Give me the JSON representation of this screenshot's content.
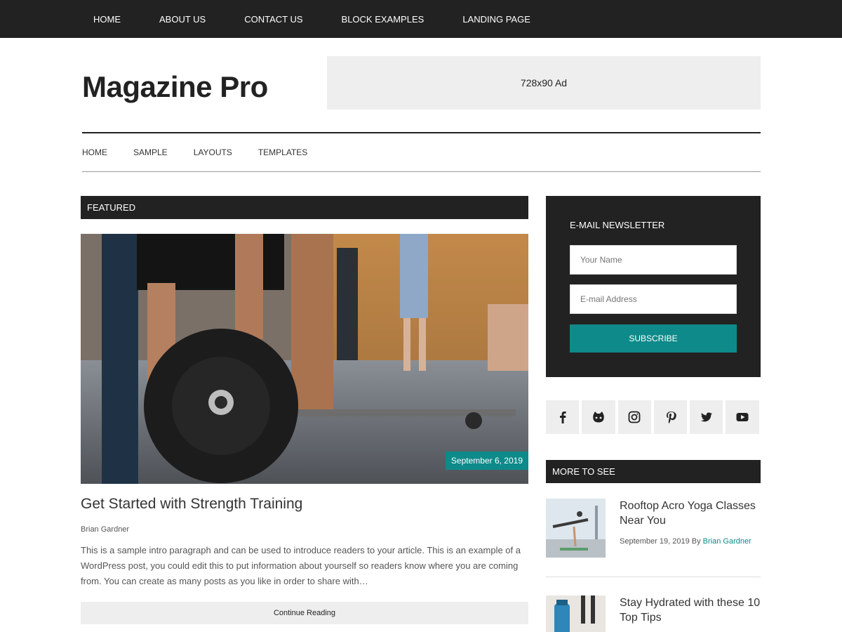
{
  "top_nav": {
    "items": [
      {
        "label": "HOME"
      },
      {
        "label": "ABOUT US"
      },
      {
        "label": "CONTACT US"
      },
      {
        "label": "BLOCK EXAMPLES"
      },
      {
        "label": "LANDING PAGE"
      }
    ]
  },
  "header": {
    "logo": "Magazine Pro",
    "ad_text": "728x90 Ad"
  },
  "secondary_nav": {
    "items": [
      {
        "label": "HOME"
      },
      {
        "label": "SAMPLE"
      },
      {
        "label": "LAYOUTS"
      },
      {
        "label": "TEMPLATES"
      }
    ]
  },
  "featured": {
    "heading": "FEATURED",
    "date": "September 6, 2019",
    "title": "Get Started with Strength Training",
    "author": "Brian Gardner",
    "excerpt": "This is a sample intro paragraph and can be used to introduce readers to your article. This is an example of a WordPress post, you could edit this to put information about yourself so readers know where you are coming from. You can create as many posts as you like in order to share with…",
    "continue_label": "Continue Reading"
  },
  "newsletter": {
    "title": "E-MAIL NEWSLETTER",
    "name_placeholder": "Your Name",
    "email_placeholder": "E-mail Address",
    "subscribe_label": "SUBSCRIBE"
  },
  "social": {
    "icons": [
      "facebook-icon",
      "github-icon",
      "instagram-icon",
      "pinterest-icon",
      "twitter-icon",
      "youtube-icon"
    ]
  },
  "more_to_see": {
    "heading": "MORE TO SEE",
    "items": [
      {
        "title": "Rooftop Acro Yoga Classes Near You",
        "date": "September 19, 2019",
        "by": "By",
        "author": "Brian Gardner"
      },
      {
        "title": "Stay Hydrated with these 10 Top Tips"
      }
    ]
  },
  "colors": {
    "dark": "#222222",
    "accent": "#0e8a8a",
    "light_gray": "#eeeeee"
  }
}
